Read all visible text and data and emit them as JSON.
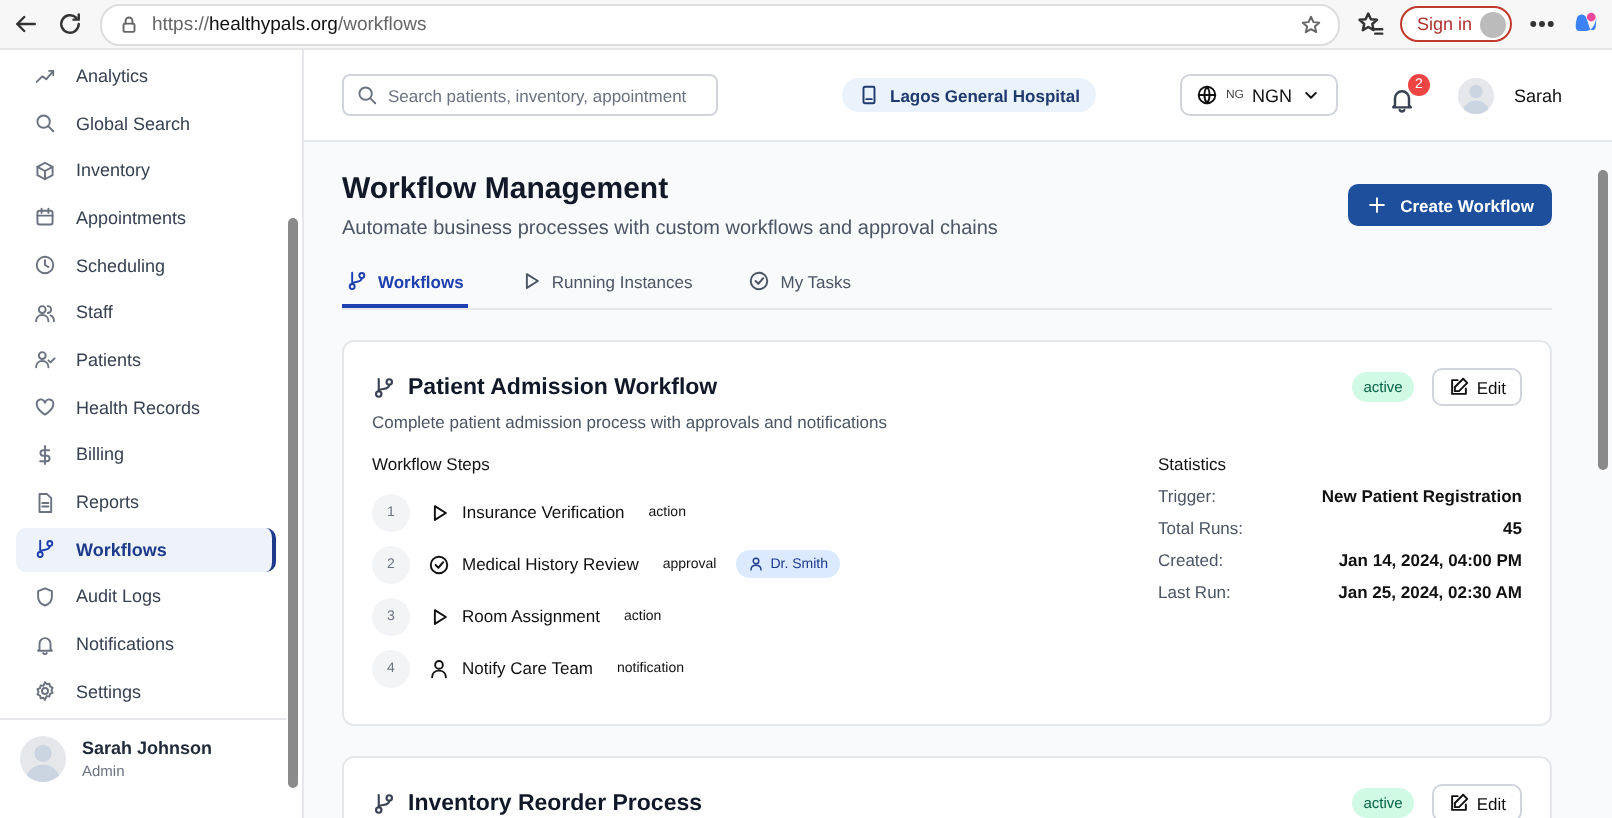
{
  "browser": {
    "url": "https://**healthypals.org**/workflows",
    "sign_in": "Sign in"
  },
  "sidebar": {
    "items": [
      {
        "label": "Analytics",
        "selected": false
      },
      {
        "label": "Global Search",
        "selected": false
      },
      {
        "label": "Inventory",
        "selected": false
      },
      {
        "label": "Appointments",
        "selected": false
      },
      {
        "label": "Scheduling",
        "selected": false
      },
      {
        "label": "Staff",
        "selected": false
      },
      {
        "label": "Patients",
        "selected": false
      },
      {
        "label": "Health Records",
        "selected": false
      },
      {
        "label": "Billing",
        "selected": false
      },
      {
        "label": "Reports",
        "selected": false
      },
      {
        "label": "Workflows",
        "selected": true
      },
      {
        "label": "Audit Logs",
        "selected": false
      },
      {
        "label": "Notifications",
        "selected": false
      },
      {
        "label": "Settings",
        "selected": false
      }
    ],
    "user": {
      "name": "Sarah Johnson",
      "role": "Admin"
    }
  },
  "header": {
    "search": {
      "placeholder": "Search patients, inventory, appointment"
    },
    "hospital": "Lagos General Hospital",
    "currency": {
      "flag": "NG",
      "code": "NGN"
    },
    "notifications": "2",
    "user": "Sarah"
  },
  "page": {
    "title": "Workflow Management",
    "subtitle": "Automate business processes with custom workflows and approval chains",
    "create_button": "Create Workflow"
  },
  "tabs": [
    {
      "label": "Workflows",
      "selected": true
    },
    {
      "label": "Running Instances",
      "selected": false
    },
    {
      "label": "My Tasks",
      "selected": false
    }
  ],
  "workflows": [
    {
      "name": "Patient Admission Workflow",
      "status": "active",
      "edit": "Edit",
      "description": "Complete patient admission process with approvals and notifications",
      "steps_heading": "Workflow Steps",
      "steps": [
        {
          "number": "1",
          "name": "Insurance Verification",
          "kind": "action"
        },
        {
          "number": "2",
          "name": "Medical History Review",
          "kind": "approval",
          "assignee": "Dr. Smith"
        },
        {
          "number": "3",
          "name": "Room Assignment",
          "kind": "action"
        },
        {
          "number": "4",
          "name": "Notify Care Team",
          "kind": "notification"
        }
      ],
      "stats_heading": "Statistics",
      "stats": [
        {
          "label": "Trigger:",
          "value": "New Patient Registration"
        },
        {
          "label": "Total Runs:",
          "value": "45"
        },
        {
          "label": "Created:",
          "value": "Jan 14, 2024, 04:00 PM"
        },
        {
          "label": "Last Run:",
          "value": "Jan 25, 2024, 02:30 AM"
        }
      ]
    },
    {
      "name": "Inventory Reorder Process",
      "status": "active",
      "edit": "Edit"
    }
  ]
}
